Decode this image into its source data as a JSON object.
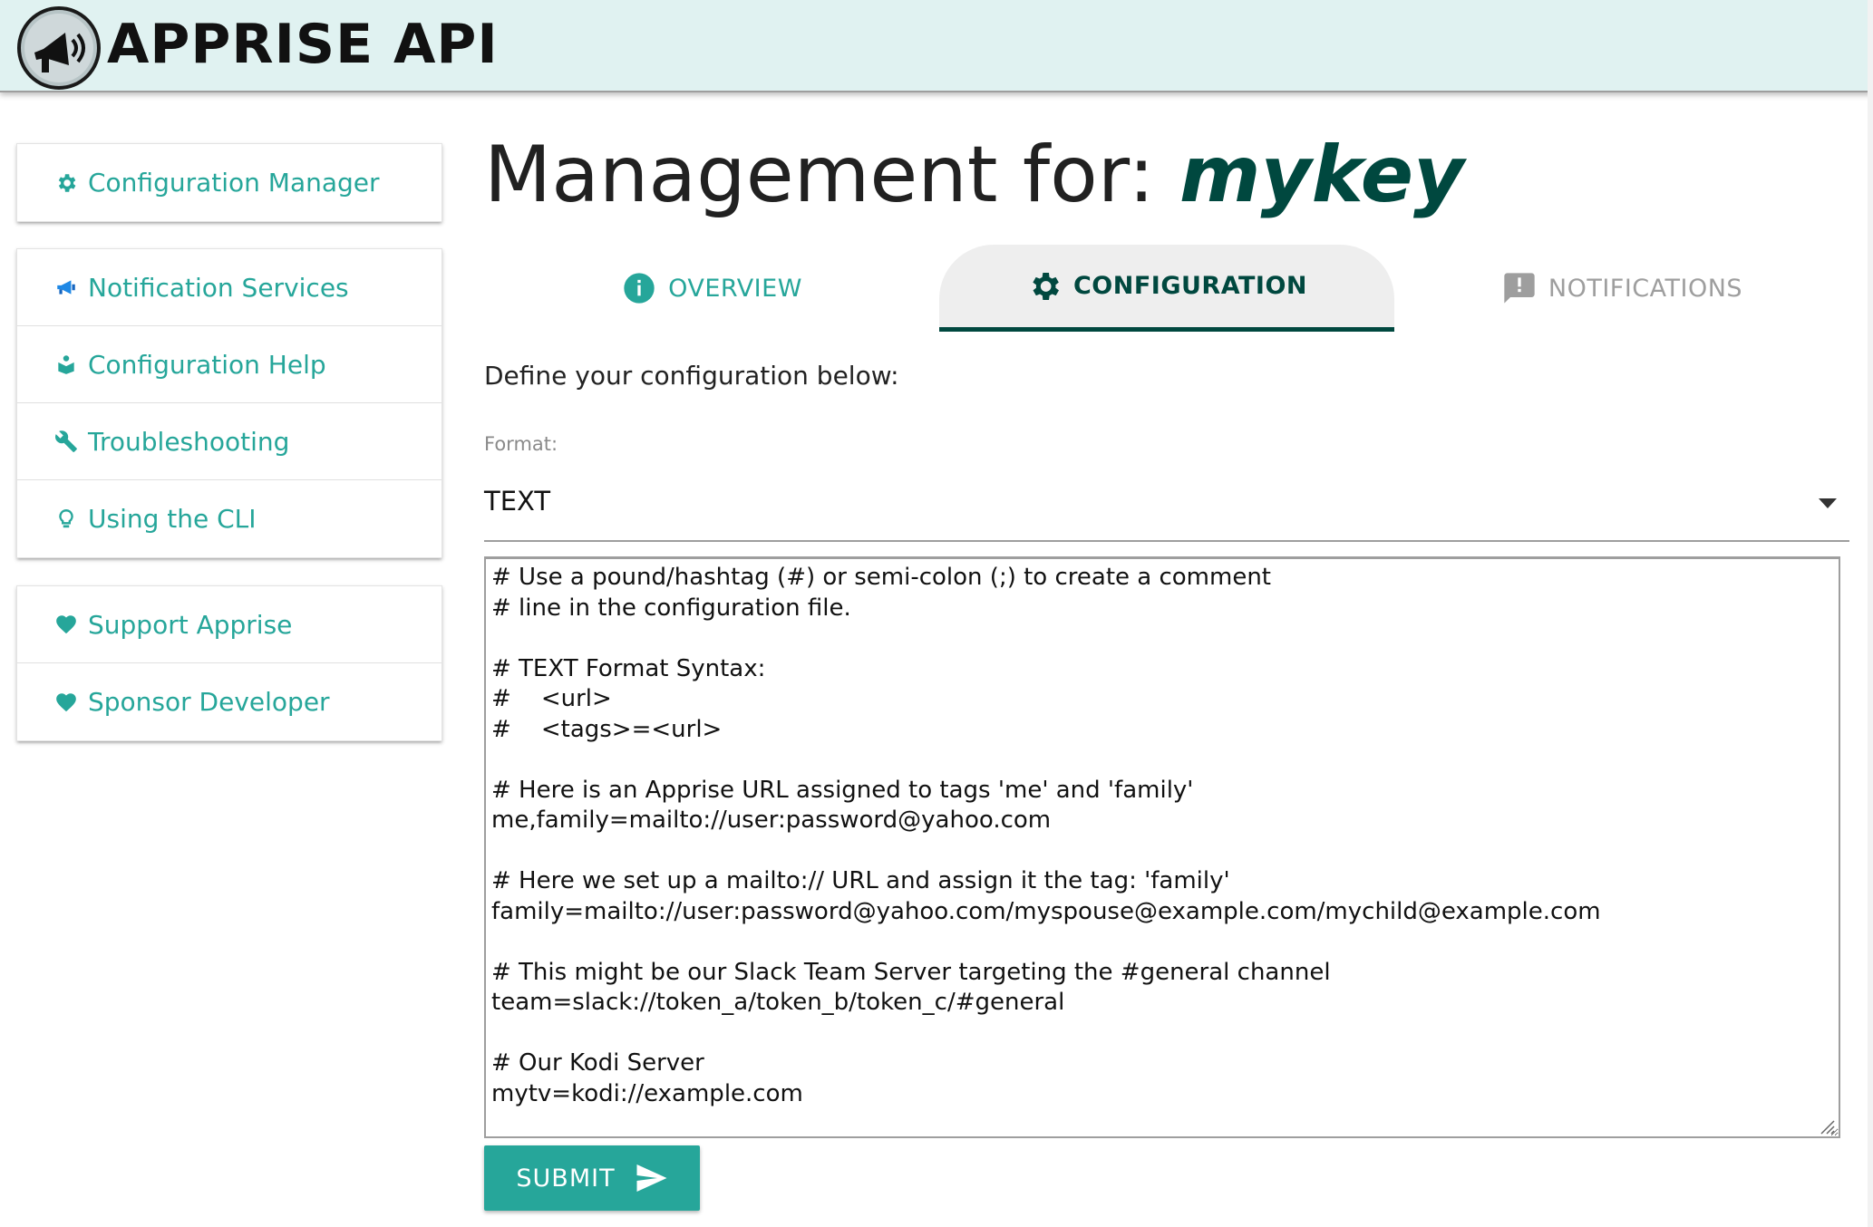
{
  "header": {
    "title": "APPRISE API"
  },
  "sidebar": {
    "groups": [
      {
        "items": [
          {
            "label": "Configuration Manager",
            "icon": "gear-icon"
          }
        ]
      },
      {
        "items": [
          {
            "label": "Notification Services",
            "icon": "megaphone-icon"
          },
          {
            "label": "Configuration Help",
            "icon": "help-book-icon"
          },
          {
            "label": "Troubleshooting",
            "icon": "wrench-icon"
          },
          {
            "label": "Using the CLI",
            "icon": "lightbulb-icon"
          }
        ]
      },
      {
        "items": [
          {
            "label": "Support Apprise",
            "icon": "heart-icon"
          },
          {
            "label": "Sponsor Developer",
            "icon": "heart-icon"
          }
        ]
      }
    ]
  },
  "main": {
    "title_prefix": "Management for: ",
    "title_key": "mykey",
    "tabs": [
      {
        "label": "OVERVIEW",
        "icon": "info-icon",
        "active": false
      },
      {
        "label": "CONFIGURATION",
        "icon": "gear-icon",
        "active": true
      },
      {
        "label": "NOTIFICATIONS",
        "icon": "feedback-icon",
        "active": false
      }
    ],
    "define_text": "Define your configuration below:",
    "format_label": "Format:",
    "format_value": "TEXT",
    "config_text": "# Use a pound/hashtag (#) or semi-colon (;) to create a comment\n# line in the configuration file.\n\n# TEXT Format Syntax:\n#    <url>\n#    <tags>=<url>\n\n# Here is an Apprise URL assigned to tags 'me' and 'family'\nme,family=mailto://user:password@yahoo.com\n\n# Here we set up a mailto:// URL and assign it the tag: 'family'\nfamily=mailto://user:password@yahoo.com/myspouse@example.com/mychild@example.com\n\n# This might be our Slack Team Server targeting the #general channel\nteam=slack://token_a/token_b/token_c/#general\n\n# Our Kodi Server\nmytv=kodi://example.com",
    "submit_label": "SUBMIT"
  },
  "colors": {
    "accent": "#26a69a",
    "dark_accent": "#00483f",
    "header_bg": "#e0f2f1",
    "muted": "#9e9e9e"
  }
}
